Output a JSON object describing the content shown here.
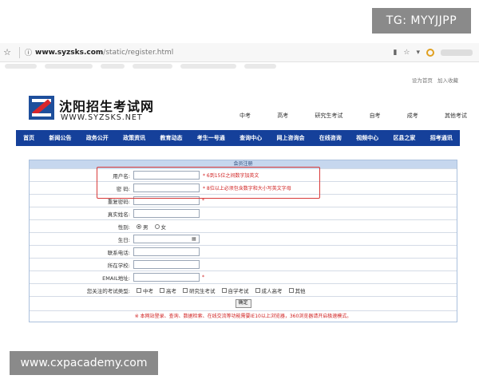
{
  "watermarks": {
    "telegram": "TG: MYYJJPP",
    "site": "www.cxpacademy.com"
  },
  "browser": {
    "star_icon": "star-icon",
    "url_host": "www.syzsks.com",
    "url_path": "/static/register.html"
  },
  "top_links": {
    "home": "设为首页",
    "fav": "加入收藏"
  },
  "header": {
    "title_cn": "沈阳招生考试网",
    "title_en": "WWW.SYZSKS.NET",
    "links": [
      "中考",
      "高考",
      "研究生考试",
      "自考",
      "成考",
      "其他考试"
    ]
  },
  "nav": [
    "首页",
    "新闻公告",
    "政务公开",
    "政策资讯",
    "教育动态",
    "考生一号通",
    "查询中心",
    "网上咨询会",
    "在线咨询",
    "视频中心",
    "区县之家",
    "招考通讯"
  ],
  "form": {
    "title": "会员注册",
    "username": {
      "label": "用户名:",
      "hint": "* 6到15位之间数字加英文"
    },
    "password": {
      "label": "密 码:",
      "hint": "* 8位以上必须包含数字和大小写英文字母"
    },
    "confirm": {
      "label": "重复密码:",
      "req": "*"
    },
    "realname": {
      "label": "真实姓名:"
    },
    "gender": {
      "label": "性别:",
      "male": "男",
      "female": "女"
    },
    "birthday": {
      "label": "生日:"
    },
    "phone": {
      "label": "联系电话:"
    },
    "school": {
      "label": "所在学校:"
    },
    "email": {
      "label": "EMAIL地址:",
      "req": "*"
    },
    "exam_types": {
      "label": "您关注的考试类型:",
      "options": [
        "中考",
        "高考",
        "研究生考试",
        "自学考试",
        "成人高考",
        "其他"
      ]
    },
    "submit": "确定",
    "notice": "※ 本网站登录、查询、数据检索、在线交流等功能需要IE10以上浏览器，360浏览器请开启极速模式。"
  }
}
